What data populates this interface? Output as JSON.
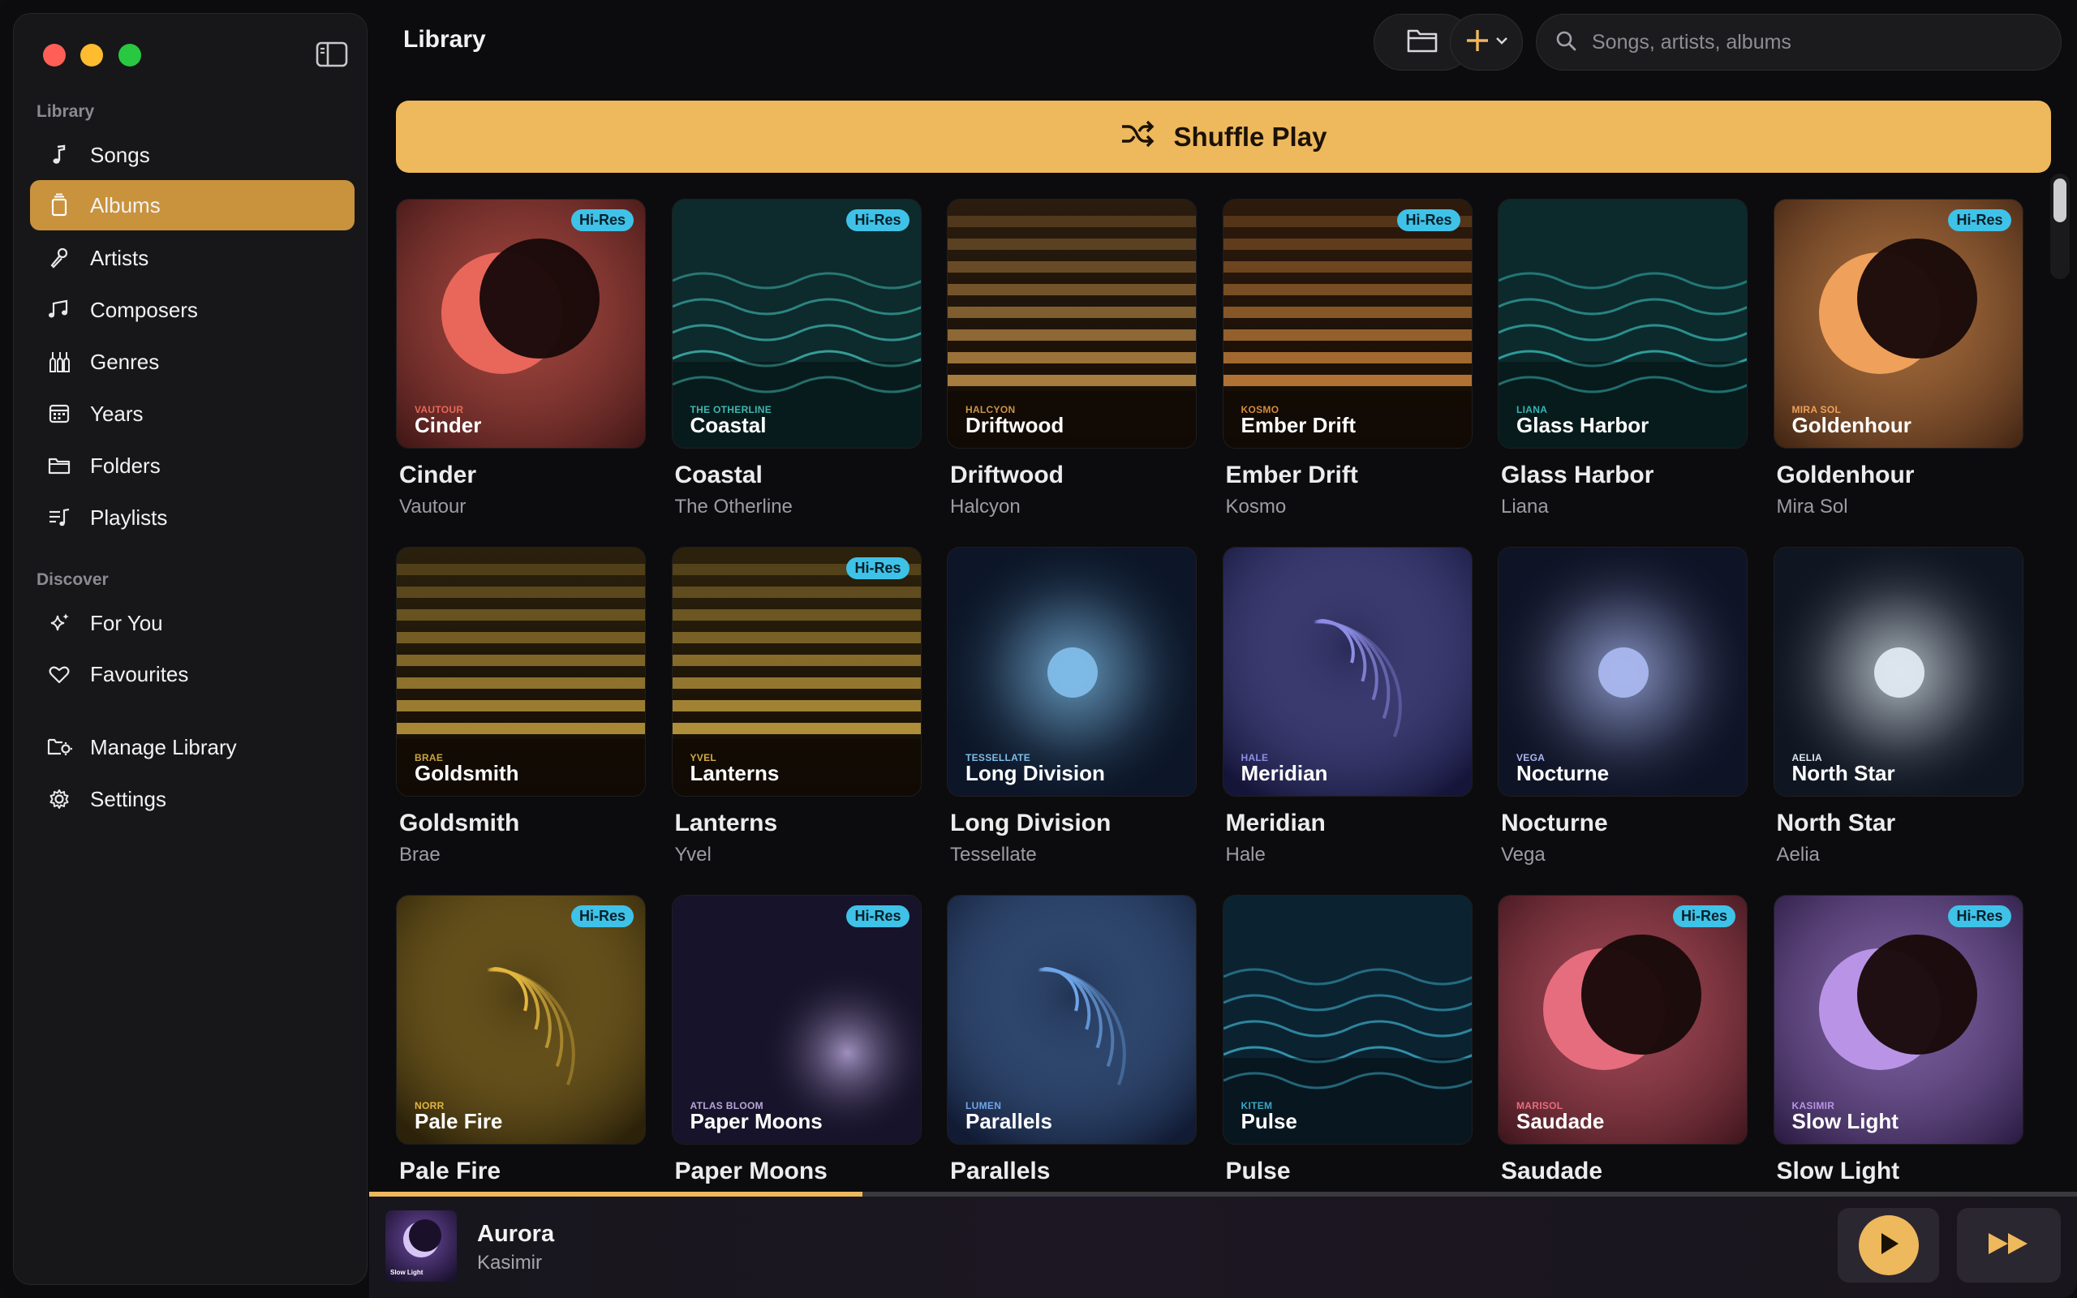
{
  "sidebar": {
    "library_label": "Library",
    "discover_label": "Discover",
    "items": [
      {
        "label": "Songs",
        "icon": "music-note-icon"
      },
      {
        "label": "Albums",
        "icon": "album-stack-icon",
        "active": true
      },
      {
        "label": "Artists",
        "icon": "microphone-icon"
      },
      {
        "label": "Composers",
        "icon": "music-notes-icon"
      },
      {
        "label": "Genres",
        "icon": "guitars-icon"
      },
      {
        "label": "Years",
        "icon": "calendar-icon"
      },
      {
        "label": "Folders",
        "icon": "folder-icon"
      },
      {
        "label": "Playlists",
        "icon": "playlist-icon"
      }
    ],
    "discover_items": [
      {
        "label": "For You",
        "icon": "sparkles-icon"
      },
      {
        "label": "Favourites",
        "icon": "heart-icon"
      }
    ],
    "bottom_items": [
      {
        "label": "Manage Library",
        "icon": "folder-gear-icon"
      },
      {
        "label": "Settings",
        "icon": "gear-icon"
      }
    ]
  },
  "header": {
    "title": "Library",
    "search_placeholder": "Songs, artists, albums"
  },
  "shuffle_label": "Shuffle Play",
  "badge_label": "Hi-Res",
  "albums": [
    {
      "title": "Cinder",
      "artist": "Vautour",
      "art_artist": "VAUTOUR",
      "style": "eclipse",
      "accent": "#e8675a",
      "bg": "#3a1414",
      "hires": true
    },
    {
      "title": "Coastal",
      "artist": "The Otherline",
      "art_artist": "THE OTHERLINE",
      "style": "waves",
      "accent": "#3fb7b0",
      "bg": "#0d2a2c",
      "hires": true
    },
    {
      "title": "Driftwood",
      "artist": "Halcyon",
      "art_artist": "HALCYON",
      "style": "stripes",
      "accent": "#c9954c",
      "bg": "#2a1c0e",
      "hires": false
    },
    {
      "title": "Ember Drift",
      "artist": "Kosmo",
      "art_artist": "KOSMO",
      "style": "stripes",
      "accent": "#d38a3f",
      "bg": "#2d1a0c",
      "hires": true
    },
    {
      "title": "Glass Harbor",
      "artist": "Liana",
      "art_artist": "LIANA",
      "style": "waves",
      "accent": "#36b5b4",
      "bg": "#0c2a2c",
      "hires": false
    },
    {
      "title": "Goldenhour",
      "artist": "Mira Sol",
      "art_artist": "MIRA SOL",
      "style": "eclipse",
      "accent": "#efa05a",
      "bg": "#3b2011",
      "hires": true
    },
    {
      "title": "Goldsmith",
      "artist": "Brae",
      "art_artist": "BRAE",
      "style": "stripes",
      "accent": "#c9a340",
      "bg": "#2a200c",
      "hires": false
    },
    {
      "title": "Lanterns",
      "artist": "Yvel",
      "art_artist": "YVEL",
      "style": "stripes",
      "accent": "#d3ab45",
      "bg": "#2c220c",
      "hires": true
    },
    {
      "title": "Long Division",
      "artist": "Tessellate",
      "art_artist": "TESSELLATE",
      "style": "orb",
      "accent": "#7fbde8",
      "bg": "#0c1628",
      "hires": false
    },
    {
      "title": "Meridian",
      "artist": "Hale",
      "art_artist": "HALE",
      "style": "arcs",
      "accent": "#8d8ee6",
      "bg": "#15153a",
      "hires": false
    },
    {
      "title": "Nocturne",
      "artist": "Vega",
      "art_artist": "VEGA",
      "style": "orb",
      "accent": "#a9b7ee",
      "bg": "#0f1326",
      "hires": false
    },
    {
      "title": "North Star",
      "artist": "Aelia",
      "art_artist": "AELIA",
      "style": "orb",
      "accent": "#dfe8f0",
      "bg": "#0f1622",
      "hires": false
    },
    {
      "title": "Pale Fire",
      "artist": "Norr",
      "art_artist": "NORR",
      "style": "arcs",
      "accent": "#e2b640",
      "bg": "#2c220a",
      "hires": true
    },
    {
      "title": "Paper Moons",
      "artist": "Atlas Bloom",
      "art_artist": "ATLAS BLOOM",
      "style": "glow",
      "accent": "#b7a6d8",
      "bg": "#17132a",
      "hires": true
    },
    {
      "title": "Parallels",
      "artist": "Lumen",
      "art_artist": "LUMEN",
      "style": "arcs",
      "accent": "#6fa6ea",
      "bg": "#111b34",
      "hires": false
    },
    {
      "title": "Pulse",
      "artist": "Kitem",
      "art_artist": "KITEM",
      "style": "waves",
      "accent": "#3aa8c6",
      "bg": "#0b2330",
      "hires": false
    },
    {
      "title": "Saudade",
      "artist": "Marisol",
      "art_artist": "MARISOL",
      "style": "eclipse",
      "accent": "#e66d7e",
      "bg": "#3a1219",
      "hires": true
    },
    {
      "title": "Slow Light",
      "artist": "Kasimir",
      "art_artist": "KASIMIR",
      "style": "eclipse",
      "accent": "#b994e6",
      "bg": "#25163c",
      "hires": true
    }
  ],
  "now_playing": {
    "title": "Aurora",
    "artist": "Kasimir",
    "art_caption": "Slow Light",
    "progress": 0.289
  },
  "colors": {
    "accent": "#eeb85c",
    "active_nav": "#c9923d",
    "badge": "#3fc2e8"
  }
}
